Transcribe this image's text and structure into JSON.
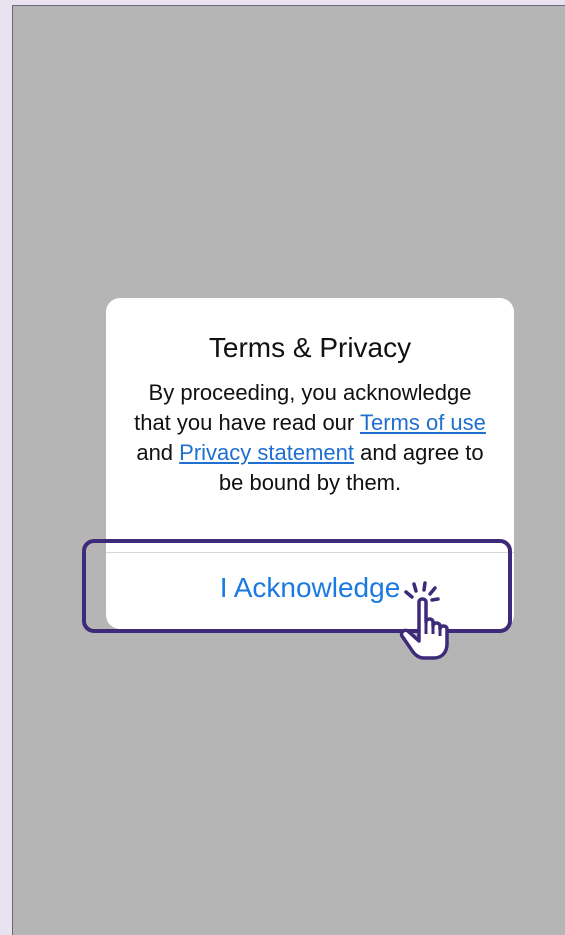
{
  "dialog": {
    "title": "Terms & Privacy",
    "body_prefix": "By proceeding, you acknowledge that you have read our ",
    "terms_link": "Terms of use",
    "body_and": " and ",
    "privacy_link": "Privacy statement",
    "body_suffix": " and agree to be bound by them.",
    "button_label": "I Acknowledge"
  },
  "colors": {
    "overlay": "#b5b5b5",
    "link": "#1f6fd0",
    "button_text": "#1a7ae0",
    "highlight": "#3d2a78"
  },
  "icons": {
    "cursor": "hand-pointer-click-icon"
  }
}
